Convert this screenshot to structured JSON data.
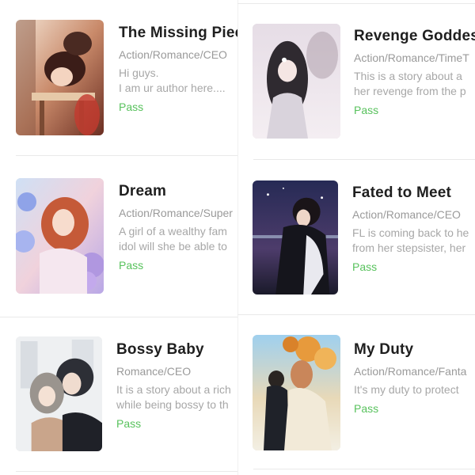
{
  "books": [
    {
      "title": "The Missing Piec",
      "genres": "Action/Romance/CEO",
      "description_lines": [
        "Hi guys.",
        "I am ur author here...."
      ],
      "status": "Pass",
      "cover_icon": "manga-cover-image"
    },
    {
      "title": "Revenge Goddes",
      "genres": "Action/Romance/TimeT",
      "description_lines": [
        "This is a story about a",
        "her revenge from the p"
      ],
      "status": "Pass",
      "cover_icon": "manga-cover-image"
    },
    {
      "title": "Dream",
      "genres": "Action/Romance/Super",
      "description_lines": [
        "A girl of a wealthy fam",
        "idol will she be able to"
      ],
      "status": "Pass",
      "cover_icon": "manga-cover-image"
    },
    {
      "title": "Fated to Meet",
      "genres": "Action/Romance/CEO",
      "description_lines": [
        "FL is coming back to he",
        "from her stepsister, her"
      ],
      "status": "Pass",
      "cover_icon": "manga-cover-image"
    },
    {
      "title": "Bossy Baby",
      "genres": "Romance/CEO",
      "description_lines": [
        "It is a story about a rich",
        "while being bossy to th"
      ],
      "status": "Pass",
      "cover_icon": "manga-cover-image"
    },
    {
      "title": "My Duty",
      "genres": "Action/Romance/Fanta",
      "description_lines": [
        "It's my duty to protect",
        ""
      ],
      "status": "Pass",
      "cover_icon": "manga-cover-image"
    }
  ],
  "colors": {
    "status_green": "#58c25d",
    "title": "#1f1f1f",
    "meta_gray": "#9a9a9a"
  }
}
